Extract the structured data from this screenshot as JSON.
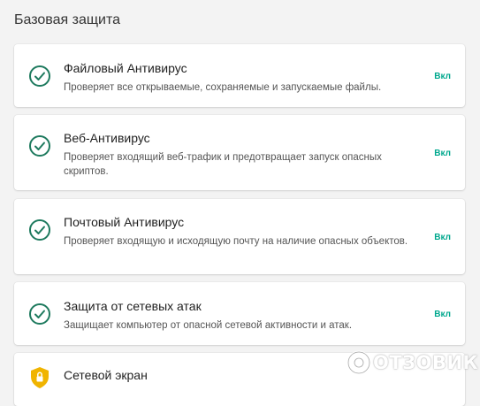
{
  "section": {
    "title": "Базовая защита"
  },
  "colors": {
    "accent": "#00a88e",
    "check_circle": "#1e7a5e",
    "shield": "#f0b400"
  },
  "cards": [
    {
      "icon": "check-circle-icon",
      "title": "Файловый Антивирус",
      "desc": "Проверяет все открываемые, сохраняемые и запускаемые файлы.",
      "status": "Вкл"
    },
    {
      "icon": "check-circle-icon",
      "title": "Веб-Антивирус",
      "desc": "Проверяет входящий веб-трафик и предотвращает запуск опасных скриптов.",
      "status": "Вкл"
    },
    {
      "icon": "check-circle-icon",
      "title": "Почтовый Антивирус",
      "desc": "Проверяет входящую и исходящую почту на наличие опасных объектов.",
      "status": "Вкл"
    },
    {
      "icon": "check-circle-icon",
      "title": "Защита от сетевых атак",
      "desc": "Защищает компьютер от опасной сетевой активности и атак.",
      "status": "Вкл"
    },
    {
      "icon": "shield-lock-icon",
      "title": "Сетевой экран"
    }
  ],
  "watermark": {
    "text": "ОТЗОВИК"
  }
}
